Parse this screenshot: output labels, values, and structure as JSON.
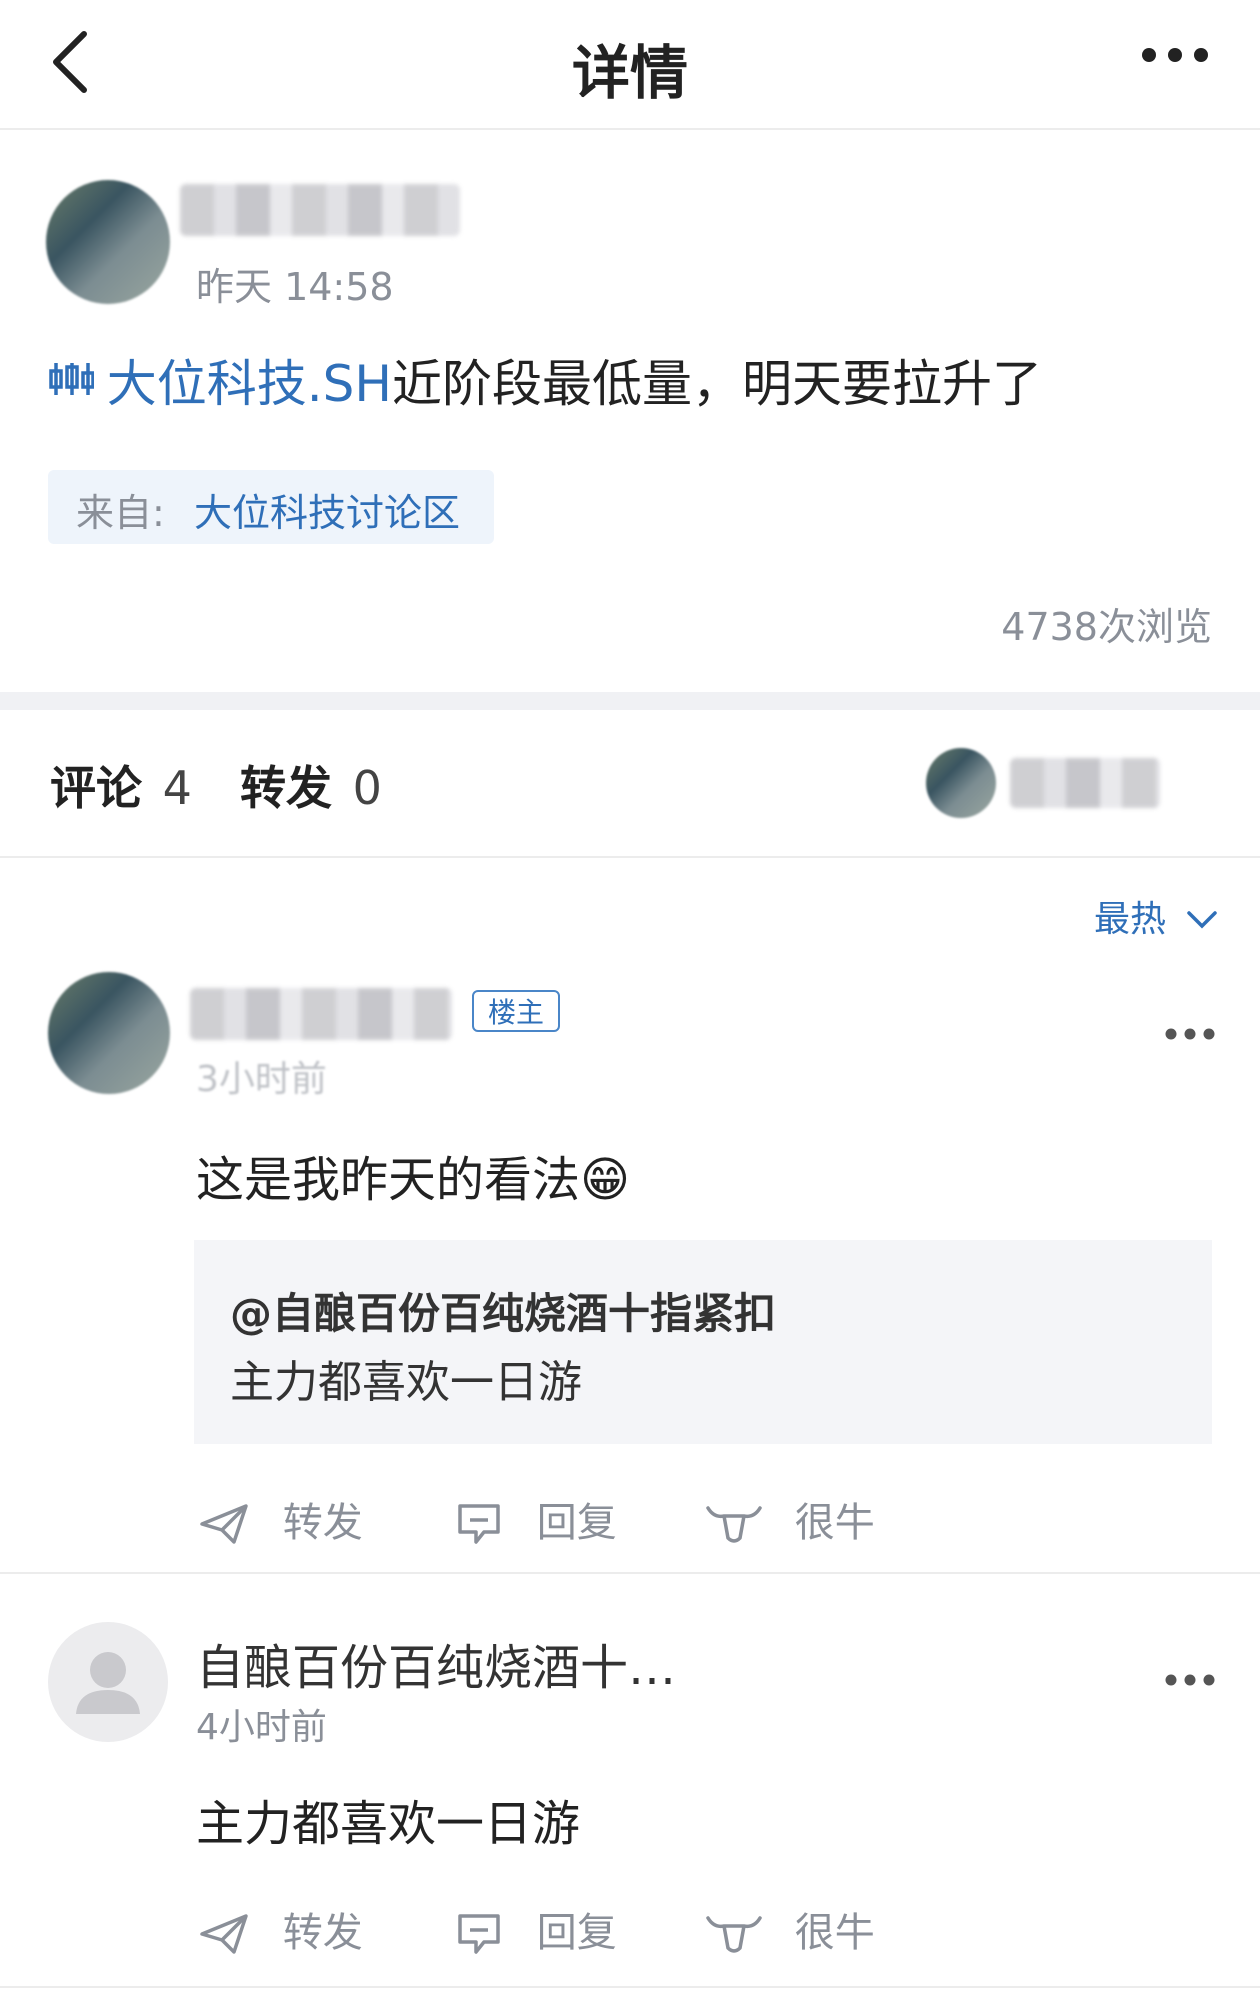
{
  "header": {
    "title": "详情"
  },
  "post": {
    "time": "昨天 14:58",
    "stock_link": "大位科技.SH",
    "content_rest": "近阶段最低量，明天要拉升了",
    "source_prefix": "来自:",
    "source_name": "大位科技讨论区",
    "views": "4738次浏览"
  },
  "tabs": {
    "comments_label": "评论",
    "comments_count": "4",
    "reposts_label": "转发",
    "reposts_count": "0"
  },
  "sort": {
    "label": "最热"
  },
  "comments": [
    {
      "badge": "楼主",
      "time": "3小时前",
      "text": "这是我昨天的看法😁",
      "quote_user": "@自酿百份百纯烧酒十指紧扣",
      "quote_text": "主力都喜欢一日游",
      "actions": [
        "转发",
        "回复",
        "很牛"
      ]
    },
    {
      "name": "自酿百份百纯烧酒十…",
      "time": "4小时前",
      "text": "主力都喜欢一日游",
      "actions": [
        "转发",
        "回复",
        "很牛"
      ]
    }
  ]
}
